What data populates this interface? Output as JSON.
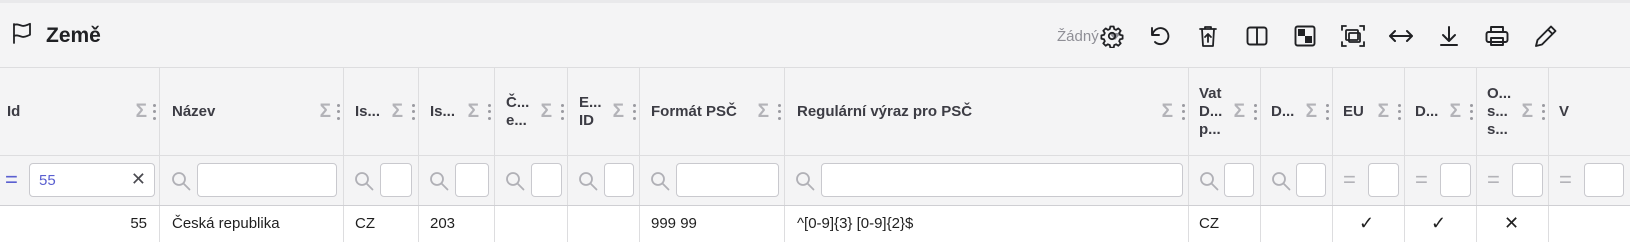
{
  "header": {
    "title": "Země",
    "view_select": "Žádný",
    "toolbar_icons": [
      "gear-icon",
      "undo-icon",
      "delete-icon",
      "split-view-icon",
      "checkerboard-icon",
      "fit-screen-icon",
      "horizontal-resize-icon",
      "download-icon",
      "print-icon",
      "edit-icon"
    ]
  },
  "columns": [
    {
      "label": "Id"
    },
    {
      "label": "Název"
    },
    {
      "label": "Is..."
    },
    {
      "label": "Is..."
    },
    {
      "label": "Č...\ne..."
    },
    {
      "label": "E...\nID"
    },
    {
      "label": "Formát PSČ"
    },
    {
      "label": "Regulární výraz pro PSČ"
    },
    {
      "label": "Vat\nD...\np..."
    },
    {
      "label": "D..."
    },
    {
      "label": "EU"
    },
    {
      "label": "D..."
    },
    {
      "label": "O...\ns...\ns..."
    },
    {
      "label": "V"
    }
  ],
  "filters": {
    "id_value": "55",
    "id_operator": "=",
    "bool_operator": "="
  },
  "row": {
    "id": "55",
    "nazev": "Česká republika",
    "iso2": "CZ",
    "iso_num": "203",
    "cislo": "",
    "eid": "",
    "format_psc": "999 99",
    "regex_psc": "^[0-9]{3} [0-9]{2}$",
    "vat": "CZ",
    "d1": "",
    "eu": "✓",
    "d2": "✓",
    "o": "✕"
  },
  "colors": {
    "accent": "#5a5fd0",
    "header_bg": "#f4f4f5",
    "muted_icon": "#b3b3b8"
  }
}
